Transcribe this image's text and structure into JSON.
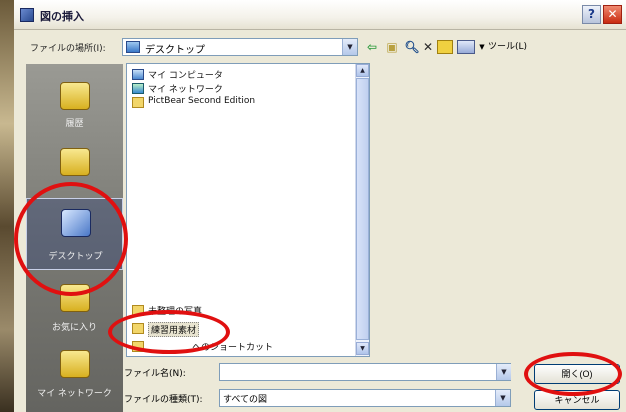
{
  "dialog": {
    "title": "図の挿入"
  },
  "lookin": {
    "label": "ファイルの場所(I):",
    "value": "デスクトップ"
  },
  "toolbar": {
    "tools_label": "ツール(L)"
  },
  "places": [
    {
      "label": "履歴"
    },
    {
      "label": ""
    },
    {
      "label": "デスクトップ"
    },
    {
      "label": "お気に入り"
    },
    {
      "label": "マイ ネットワーク"
    }
  ],
  "files": [
    {
      "name": "マイ コンピュータ",
      "icon": "computer-icon"
    },
    {
      "name": "マイ ネットワーク",
      "icon": "network-icon"
    },
    {
      "name": "PictBear Second Edition",
      "icon": "folder-icon"
    },
    {
      "name": "未整理の写真",
      "icon": "folder-icon"
    },
    {
      "name": "練習用素材",
      "icon": "folder-icon"
    },
    {
      "name": "ヘのショートカット",
      "icon": "folder-icon"
    }
  ],
  "filename": {
    "label": "ファイル名(N):",
    "value": ""
  },
  "filetype": {
    "label": "ファイルの種類(T):",
    "value": "すべての図"
  },
  "buttons": {
    "open": "開く(O)",
    "cancel": "キャンセル"
  },
  "colors": {
    "annotation": "#e01010",
    "places_bar": "#7a7a74",
    "dialog_bg": "#ece9d8"
  }
}
